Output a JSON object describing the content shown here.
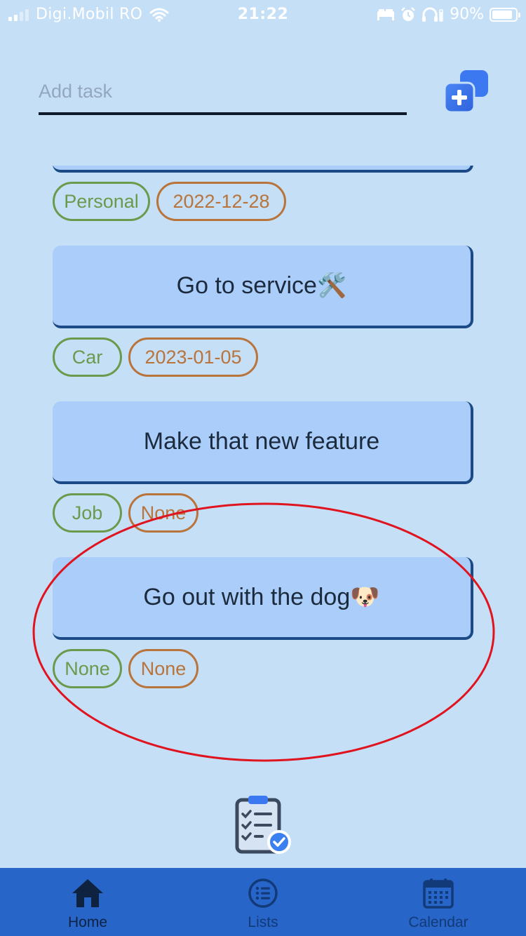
{
  "status_bar": {
    "carrier": "Digi.Mobil RO",
    "time": "21:22",
    "battery": "90%",
    "battery_level": 0.9,
    "icons": [
      "signal-icon",
      "wifi-icon",
      "bed-icon",
      "alarm-icon",
      "headphones-icon",
      "battery-icon"
    ]
  },
  "add_task": {
    "placeholder": "Add task",
    "value": "",
    "button_icon": "add-task-icon"
  },
  "tasks": [
    {
      "title": "",
      "category": "Personal",
      "date": "2022-12-28",
      "partially_visible": true
    },
    {
      "title": "Go to service🛠️",
      "category": "Car",
      "date": "2023-01-05"
    },
    {
      "title": "Make that new feature",
      "category": "Job",
      "date": "None"
    },
    {
      "title": "Go out with the dog🐶",
      "category": "None",
      "date": "None"
    }
  ],
  "center_icon": "clipboard-checklist-icon",
  "tab_bar": {
    "tabs": [
      {
        "label": "Home",
        "icon": "home-icon",
        "active": true
      },
      {
        "label": "Lists",
        "icon": "list-icon",
        "active": false
      },
      {
        "label": "Calendar",
        "icon": "calendar-icon",
        "active": false
      }
    ]
  },
  "colors": {
    "background": "#c5dff7",
    "card": "#aacdfa",
    "card_shadow": "#1b4a86",
    "category_tag": "#6a9a4c",
    "date_tag": "#b8743a",
    "tab_bar": "#2865c8",
    "annotation": "#e0141e"
  }
}
